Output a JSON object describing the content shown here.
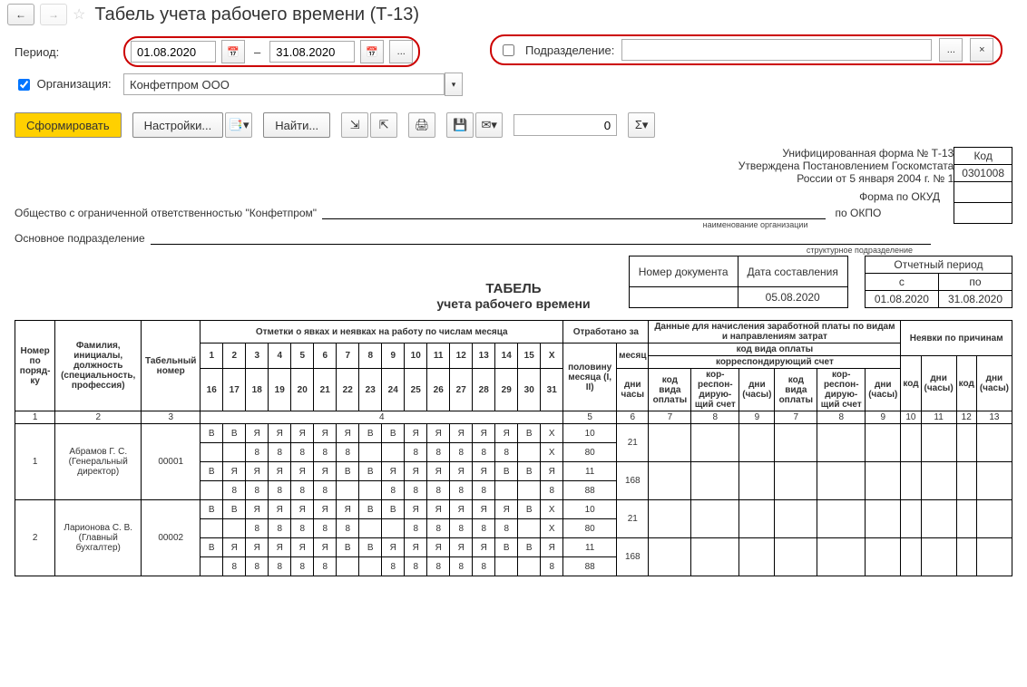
{
  "header": {
    "title": "Табель учета рабочего времени (Т-13)"
  },
  "filters": {
    "period_label": "Период:",
    "date_from": "01.08.2020",
    "date_to": "31.08.2020",
    "dash": "–",
    "org_label": "Организация:",
    "org_value": "Конфетпром ООО",
    "subdiv_label": "Подразделение:"
  },
  "toolbar": {
    "form": "Сформировать",
    "settings": "Настройки...",
    "find": "Найти...",
    "num": "0"
  },
  "report": {
    "form_line1": "Унифицированная форма № Т-13",
    "form_line2": "Утверждена Постановлением Госкомстата",
    "form_line3": "России от 5 января 2004 г. № 1",
    "code_hdr": "Код",
    "okud_label": "Форма по ОКУД",
    "okud": "0301008",
    "okpo_label": "по ОКПО",
    "org_name": "Общество с ограниченной ответственностью \"Конфетпром\"",
    "org_sub": "наименование организации",
    "dept": "Основное подразделение",
    "dept_sub": "структурное подразделение",
    "doc_num_hdr": "Номер документа",
    "doc_date_hdr": "Дата составления",
    "doc_date": "05.08.2020",
    "period_hdr": "Отчетный период",
    "period_from_hdr": "с",
    "period_to_hdr": "по",
    "period_from": "01.08.2020",
    "period_to": "31.08.2020",
    "title": "ТАБЕЛЬ",
    "subtitle": "учета  рабочего времени"
  },
  "cols": {
    "c1": "Номер по поряд-ку",
    "c2": "Фамилия, инициалы, должность (специальность, профессия)",
    "c3": "Табельный номер",
    "c4": "Отметки о явках и неявках на работу по числам месяца",
    "c5": "Отработано за",
    "c5a": "половину месяца (I, II)",
    "c5b": "месяц",
    "c5c": "дни",
    "c5d": "часы",
    "c6": "Данные для начисления заработной платы по видам и направлениям затрат",
    "c6a": "код вида оплаты",
    "c6b": "корреспондирующий счет",
    "c6c": "код вида оплаты",
    "c6d": "кор-респон-дирую-щий счет",
    "c6e": "дни (часы)",
    "c7": "Неявки по причинам",
    "c7a": "код",
    "c7b": "дни (часы)",
    "x": "X",
    "n1": "1",
    "n2": "2",
    "n3": "3",
    "n4": "4",
    "n5": "5",
    "n6": "6",
    "n7": "7",
    "n8": "8",
    "n9": "9",
    "n10": "10",
    "n11": "11",
    "n12": "12",
    "n13": "13"
  },
  "days1": [
    "1",
    "2",
    "3",
    "4",
    "5",
    "6",
    "7",
    "8",
    "9",
    "10",
    "11",
    "12",
    "13",
    "14",
    "15"
  ],
  "days2": [
    "16",
    "17",
    "18",
    "19",
    "20",
    "21",
    "22",
    "23",
    "24",
    "25",
    "26",
    "27",
    "28",
    "29",
    "30",
    "31"
  ],
  "rows": [
    {
      "num": "1",
      "name": "Абрамов Г. С. (Генеральный директор)",
      "tab": "00001",
      "r1": [
        "В",
        "В",
        "Я",
        "Я",
        "Я",
        "Я",
        "Я",
        "В",
        "В",
        "Я",
        "Я",
        "Я",
        "Я",
        "Я",
        "В"
      ],
      "r2": [
        "",
        "",
        "8",
        "8",
        "8",
        "8",
        "8",
        "",
        "",
        "8",
        "8",
        "8",
        "8",
        "8",
        ""
      ],
      "r3": [
        "В",
        "Я",
        "Я",
        "Я",
        "Я",
        "Я",
        "В",
        "В",
        "Я",
        "Я",
        "Я",
        "Я",
        "Я",
        "В",
        "В",
        "Я"
      ],
      "r4": [
        "",
        "8",
        "8",
        "8",
        "8",
        "8",
        "",
        "",
        "8",
        "8",
        "8",
        "8",
        "8",
        "",
        "",
        "8"
      ],
      "half1_d": "10",
      "half1_h": "80",
      "half2_d": "11",
      "half2_h": "88",
      "mon_d": "21",
      "mon_h": "168"
    },
    {
      "num": "2",
      "name": "Ларионова С. В. (Главный бухгалтер)",
      "tab": "00002",
      "r1": [
        "В",
        "В",
        "Я",
        "Я",
        "Я",
        "Я",
        "Я",
        "В",
        "В",
        "Я",
        "Я",
        "Я",
        "Я",
        "Я",
        "В"
      ],
      "r2": [
        "",
        "",
        "8",
        "8",
        "8",
        "8",
        "8",
        "",
        "",
        "8",
        "8",
        "8",
        "8",
        "8",
        ""
      ],
      "r3": [
        "В",
        "Я",
        "Я",
        "Я",
        "Я",
        "Я",
        "В",
        "В",
        "Я",
        "Я",
        "Я",
        "Я",
        "Я",
        "В",
        "В",
        "Я"
      ],
      "r4": [
        "",
        "8",
        "8",
        "8",
        "8",
        "8",
        "",
        "",
        "8",
        "8",
        "8",
        "8",
        "8",
        "",
        "",
        "8"
      ],
      "half1_d": "10",
      "half1_h": "80",
      "half2_d": "11",
      "half2_h": "88",
      "mon_d": "21",
      "mon_h": "168"
    }
  ]
}
